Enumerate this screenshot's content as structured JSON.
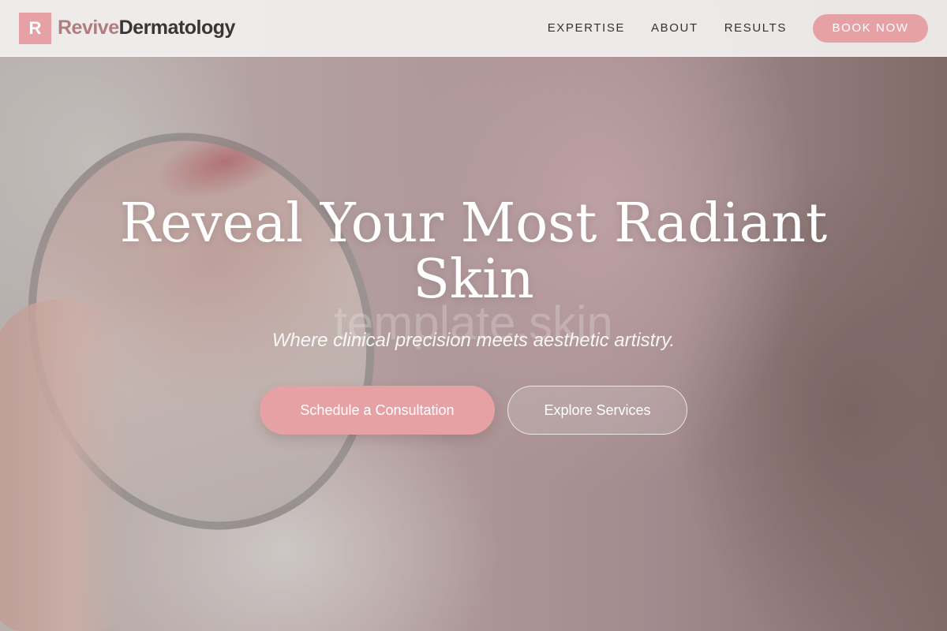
{
  "header": {
    "logo_letter": "R",
    "brand_part1": "Revive",
    "brand_part2": "Dermatology",
    "nav": [
      "EXPERTISE",
      "ABOUT",
      "RESULTS"
    ],
    "cta": "BOOK NOW"
  },
  "hero": {
    "title": "Reveal Your Most Radiant Skin",
    "watermark": "template.skin",
    "subtitle": "Where clinical precision meets aesthetic artistry.",
    "primary_cta": "Schedule a Consultation",
    "secondary_cta": "Explore Services"
  },
  "colors": {
    "accent": "#e6a1a5",
    "brand_muted": "#b07c80",
    "text_dark": "#3b3535"
  }
}
